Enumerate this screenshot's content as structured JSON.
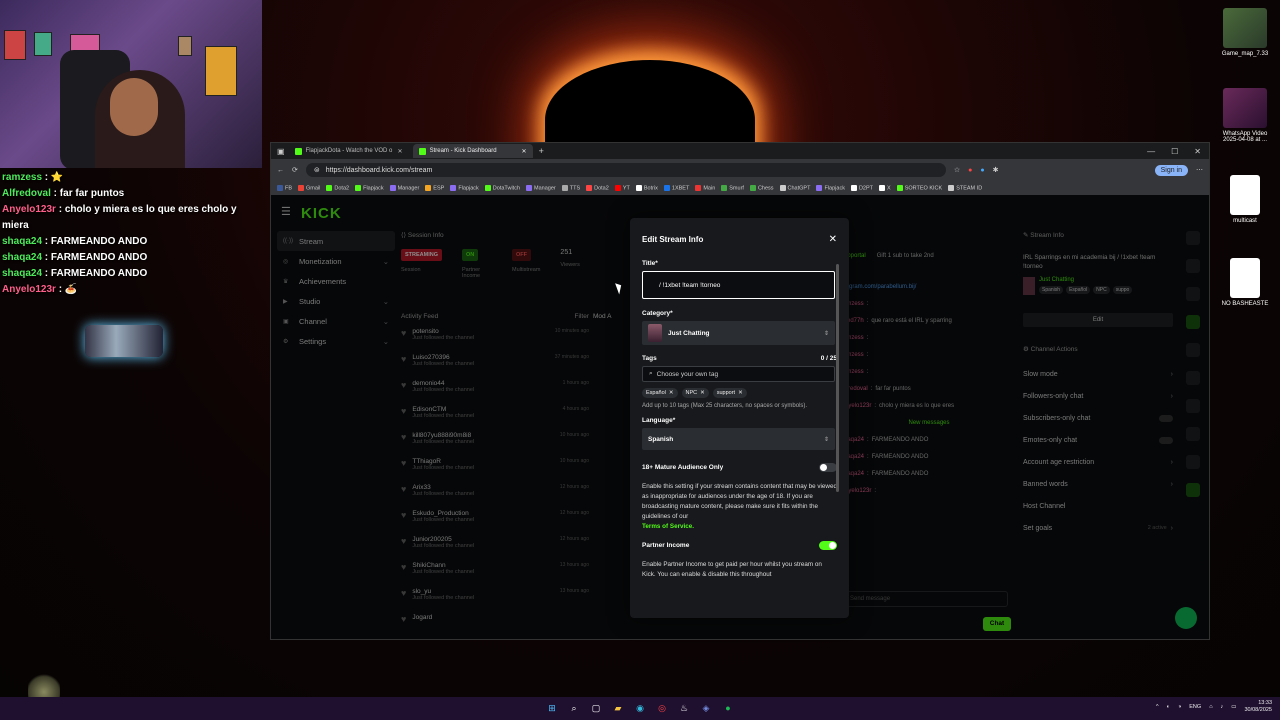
{
  "overlay_chat": [
    {
      "user": "ramzess",
      "msg": "⭐",
      "color": "green"
    },
    {
      "user": "Alfredoval",
      "msg": "far far puntos",
      "color": "green"
    },
    {
      "user": "Anyelo123r",
      "msg": "cholo y miera es lo que eres cholo y miera",
      "color": "pink"
    },
    {
      "user": "shaqa24",
      "msg": "FARMEANDO ANDO",
      "color": "green"
    },
    {
      "user": "shaqa24",
      "msg": "FARMEANDO ANDO",
      "color": "green"
    },
    {
      "user": "shaqa24",
      "msg": "FARMEANDO ANDO",
      "color": "green"
    },
    {
      "user": "Anyelo123r",
      "msg": "🍝",
      "color": "pink"
    }
  ],
  "desktop_icons": [
    {
      "label": "Game_map_7.33"
    },
    {
      "label": "WhatsApp Video 2025-04-08 at ..."
    },
    {
      "label": "multicast"
    },
    {
      "label": "NO BASHEASTE"
    }
  ],
  "browser": {
    "tabs": [
      {
        "label": "FlapjackDota - Watch the VOD o"
      },
      {
        "label": "Stream - Kick Dashboard"
      }
    ],
    "new_tab": "+",
    "url": "https://dashboard.kick.com/stream",
    "sign_in": "Sign in",
    "bookmarks": [
      "FB",
      "Gmail",
      "Dota2",
      "Flapjack",
      "Manager",
      "ESP",
      "Flapjack",
      "DotaTwitch",
      "Manager",
      "TTS",
      "Dota2",
      "YT",
      "Botrix",
      "1XBET",
      "Main",
      "Smurf",
      "Chess",
      "ChatGPT",
      "Flapjack",
      "D2PT",
      "X",
      "SORTEO KICK",
      "STEAM ID"
    ]
  },
  "kick": {
    "logo": "KICK",
    "nav": [
      {
        "label": "Stream",
        "icon": "signal-icon",
        "chevron": false,
        "active": true
      },
      {
        "label": "Monetization",
        "icon": "coin-icon",
        "chevron": true
      },
      {
        "label": "Achievements",
        "icon": "trophy-icon",
        "chevron": false
      },
      {
        "label": "Studio",
        "icon": "studio-icon",
        "chevron": true
      },
      {
        "label": "Channel",
        "icon": "channel-icon",
        "chevron": true
      },
      {
        "label": "Settings",
        "icon": "gear-icon",
        "chevron": true
      }
    ],
    "session_info": {
      "heading": "Session Info",
      "streaming": "STREAMING",
      "session_label": "Session",
      "partner_badge": "ON",
      "partner_label": "Partner Income",
      "multistream_badge": "OFF",
      "multistream_label": "Multistream",
      "viewers_value": "251",
      "viewers_label": "Viewers"
    },
    "activity_feed": {
      "heading": "Activity Feed",
      "filter": "Filter",
      "mod_heading": "Mod A",
      "items": [
        {
          "name": "potensito",
          "sub": "Just followed the channel",
          "time": "10 minutes ago"
        },
        {
          "name": "Luiso270396",
          "sub": "Just followed the channel",
          "time": "37 minutes ago"
        },
        {
          "name": "demonio44",
          "sub": "Just followed the channel",
          "time": "1 hours ago"
        },
        {
          "name": "EdisonCTM",
          "sub": "Just followed the channel",
          "time": "4 hours ago"
        },
        {
          "name": "kill807yu888i90m8i8",
          "sub": "Just followed the channel",
          "time": "10 hours ago"
        },
        {
          "name": "TThiagoR",
          "sub": "Just followed the channel",
          "time": "10 hours ago"
        },
        {
          "name": "Arix33",
          "sub": "Just followed the channel",
          "time": "12 hours ago"
        },
        {
          "name": "Eskudo_Production",
          "sub": "Just followed the channel",
          "time": "12 hours ago"
        },
        {
          "name": "Junior200205",
          "sub": "Just followed the channel",
          "time": "12 hours ago"
        },
        {
          "name": "ShikiChann",
          "sub": "Just followed the channel",
          "time": "13 hours ago"
        },
        {
          "name": "slo_yu",
          "sub": "Just followed the channel",
          "time": "13 hours ago"
        },
        {
          "name": "Jogard",
          "sub": "",
          "time": ""
        }
      ]
    },
    "chat_panel": {
      "top_user": "sobportal",
      "gift_line": "Gift 1 sub to take 2nd",
      "link": "stagram.com/parabellum.bij/",
      "lines": [
        {
          "user": "ramzess",
          "msg": ""
        },
        {
          "user": "fixed77h",
          "msg": "que raro está el IRL y sparring"
        },
        {
          "user": "ramzess",
          "msg": ""
        },
        {
          "user": "ramzess",
          "msg": ""
        },
        {
          "user": "ramzess",
          "msg": ""
        },
        {
          "user": "Alfredoval",
          "msg": "far far puntos"
        },
        {
          "user": "Anyelo123r",
          "msg": "cholo y miera es lo que eres"
        },
        {
          "user": "shaqa24",
          "msg": "FARMEANDO ANDO"
        },
        {
          "user": "shaqa24",
          "msg": "FARMEANDO ANDO"
        },
        {
          "user": "shaqa24",
          "msg": "FARMEANDO ANDO"
        },
        {
          "user": "Anyelo123r",
          "msg": ""
        }
      ],
      "new_messages": "New messages",
      "input_placeholder": "Send message",
      "chat_button": "Chat"
    },
    "stream_info_panel": {
      "heading": "Stream Info",
      "title": "IRL Sparrings en mi academia bij / !1xbet !team !torneo",
      "category": "Just Chatting",
      "tags": [
        "Spanish",
        "Español",
        "NPC",
        "suppo"
      ],
      "edit": "Edit"
    },
    "channel_actions": {
      "heading": "Channel Actions",
      "rows": [
        {
          "label": "Slow mode",
          "control": "chevron"
        },
        {
          "label": "Followers-only chat",
          "control": "chevron"
        },
        {
          "label": "Subscribers-only chat",
          "control": "toggle"
        },
        {
          "label": "Emotes-only chat",
          "control": "toggle"
        },
        {
          "label": "Account age restriction",
          "control": "chevron"
        },
        {
          "label": "Banned words",
          "control": "chevron"
        },
        {
          "label": "Host Channel",
          "control": "none"
        },
        {
          "label": "Set goals",
          "control": "chevron",
          "extra": "2 active"
        }
      ]
    }
  },
  "modal": {
    "heading": "Edit Stream Info",
    "title_label": "Title*",
    "title_value": "/ !1xbet !team !torneo",
    "category_label": "Category*",
    "category_value": "Just Chatting",
    "tags_label": "Tags",
    "tags_count": "0 / 25",
    "tag_placeholder": "Choose your own tag",
    "tags": [
      "Español",
      "NPC",
      "support"
    ],
    "tags_help": "Add up to 10 tags (Max 25 characters, no spaces or symbols).",
    "language_label": "Language*",
    "language_value": "Spanish",
    "mature_label": "18+ Mature Audience Only",
    "mature_on": false,
    "mature_help": "Enable this setting if your stream contains content that may be viewed as inappropriate for audiences under the age of 18. If you are broadcasting mature content, please make sure it fits within the guidelines of our",
    "mature_link": "Terms of Service.",
    "partner_label": "Partner Income",
    "partner_on": true,
    "partner_help": "Enable Partner Income to get paid per hour whilst you stream on Kick. You can enable & disable this throughout"
  },
  "taskbar": {
    "lang": "ENG",
    "time": "13:33",
    "date": "30/08/2025"
  },
  "colors": {
    "kick_green": "#53fc18",
    "modal_bg": "#17191c",
    "taskbar_bg": "#1f1030"
  }
}
